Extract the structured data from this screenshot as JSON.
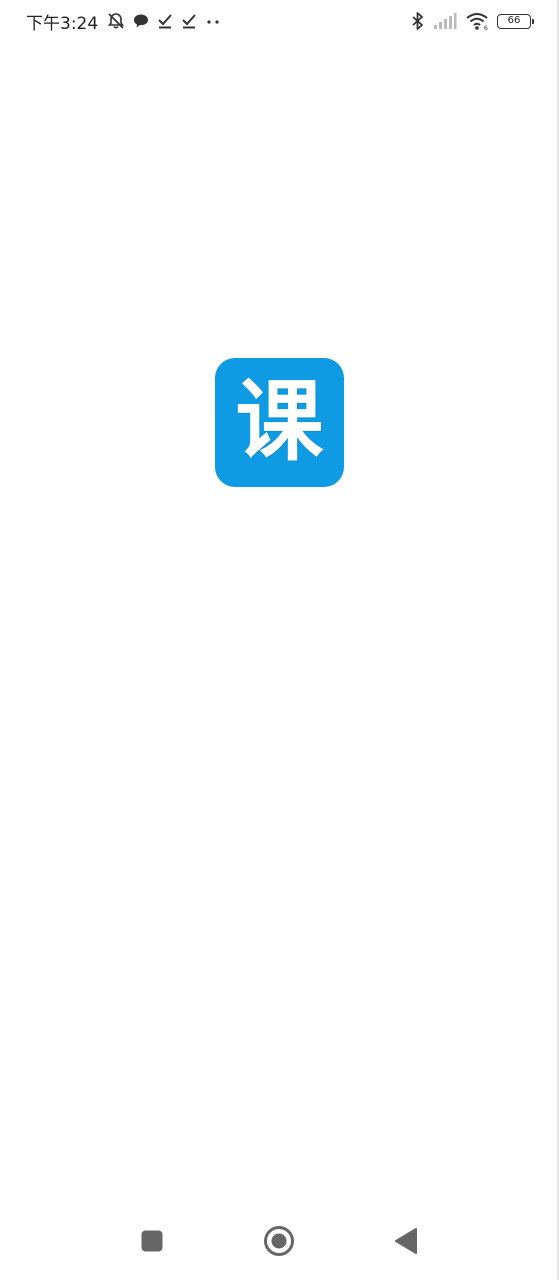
{
  "status_bar": {
    "time": "下午3:24",
    "battery_level": "66",
    "left_icons": [
      "bell-muted-icon",
      "chat-bubble-icon",
      "check-icon",
      "check-icon",
      "more-dots-icon"
    ],
    "right_icons": [
      "bluetooth-icon",
      "signal-icon",
      "wifi-icon",
      "battery-icon"
    ]
  },
  "splash": {
    "logo_glyph": "课",
    "logo_color": "#0e9be4"
  },
  "nav_bar": {
    "buttons": [
      "recent-apps",
      "home",
      "back"
    ],
    "color": "#666666"
  }
}
